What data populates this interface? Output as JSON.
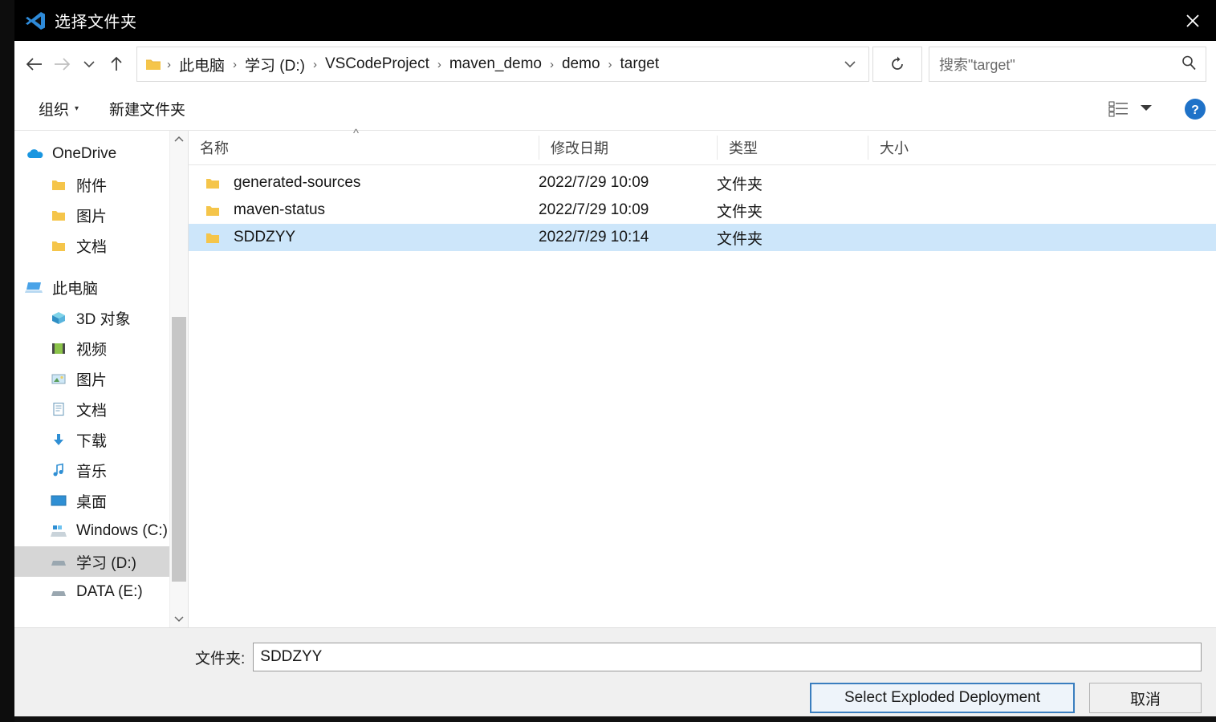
{
  "window": {
    "title": "选择文件夹",
    "app_icon": "vscode-icon",
    "close_icon": "close-icon"
  },
  "nav": {
    "back_icon": "arrow-left-icon",
    "forward_icon": "arrow-right-icon",
    "recent_icon": "chevron-down-icon",
    "up_icon": "arrow-up-icon",
    "refresh_icon": "refresh-icon",
    "address_chevron_icon": "chevron-down-icon",
    "breadcrumb_folder_icon": "folder-icon",
    "breadcrumbs": [
      "此电脑",
      "学习 (D:)",
      "VSCodeProject",
      "maven_demo",
      "demo",
      "target"
    ],
    "separator": "›"
  },
  "search": {
    "placeholder": "搜索\"target\"",
    "icon": "search-icon"
  },
  "toolbar": {
    "organize_label": "组织",
    "organize_caret": "▾",
    "new_folder_label": "新建文件夹",
    "view_icon": "view-layout-icon",
    "view_caret_icon": "caret-down-icon",
    "help_icon": "help-icon"
  },
  "sidebar": {
    "groups": [
      {
        "items": [
          {
            "label": "OneDrive",
            "icon": "onedrive-cloud-icon",
            "level": "root",
            "selected": false
          },
          {
            "label": "附件",
            "icon": "folder-icon",
            "level": "indent",
            "selected": false
          },
          {
            "label": "图片",
            "icon": "folder-icon",
            "level": "indent",
            "selected": false
          },
          {
            "label": "文档",
            "icon": "folder-icon",
            "level": "indent",
            "selected": false
          }
        ]
      },
      {
        "items": [
          {
            "label": "此电脑",
            "icon": "this-pc-icon",
            "level": "root",
            "selected": false
          },
          {
            "label": "3D 对象",
            "icon": "3d-objects-icon",
            "level": "indent",
            "selected": false
          },
          {
            "label": "视频",
            "icon": "videos-icon",
            "level": "indent",
            "selected": false
          },
          {
            "label": "图片",
            "icon": "pictures-icon",
            "level": "indent",
            "selected": false
          },
          {
            "label": "文档",
            "icon": "documents-icon",
            "level": "indent",
            "selected": false
          },
          {
            "label": "下载",
            "icon": "downloads-icon",
            "level": "indent",
            "selected": false
          },
          {
            "label": "音乐",
            "icon": "music-icon",
            "level": "indent",
            "selected": false
          },
          {
            "label": "桌面",
            "icon": "desktop-icon",
            "level": "indent",
            "selected": false
          },
          {
            "label": "Windows (C:)",
            "icon": "windows-drive-icon",
            "level": "indent",
            "selected": false
          },
          {
            "label": "学习 (D:)",
            "icon": "drive-icon",
            "level": "indent",
            "selected": true
          },
          {
            "label": "DATA (E:)",
            "icon": "drive-icon",
            "level": "indent",
            "selected": false
          }
        ]
      }
    ],
    "scroll_up_icon": "chevron-up-icon",
    "scroll_down_icon": "chevron-down-icon"
  },
  "filelist": {
    "columns": [
      "名称",
      "修改日期",
      "类型",
      "大小"
    ],
    "sort_column": "名称",
    "sort_caret": "^",
    "rows": [
      {
        "name": "generated-sources",
        "date": "2022/7/29 10:09",
        "type": "文件夹",
        "size": "",
        "icon": "folder-icon",
        "selected": false
      },
      {
        "name": "maven-status",
        "date": "2022/7/29 10:09",
        "type": "文件夹",
        "size": "",
        "icon": "folder-icon",
        "selected": false
      },
      {
        "name": "SDDZYY",
        "date": "2022/7/29 10:14",
        "type": "文件夹",
        "size": "",
        "icon": "folder-icon",
        "selected": true
      }
    ]
  },
  "footer": {
    "folder_label": "文件夹:",
    "folder_value": "SDDZYY",
    "confirm_label": "Select Exploded Deployment",
    "cancel_label": "取消"
  },
  "colors": {
    "titlebar_bg": "#000000",
    "selection_blue": "#cde6fa",
    "sidebar_selection_grey": "#d6d6d6",
    "accent_blue": "#3a7ebf",
    "folder_yellow": "#f5c54a",
    "help_blue": "#1f72c8",
    "desktop_icon_orange": "#e8622c"
  }
}
